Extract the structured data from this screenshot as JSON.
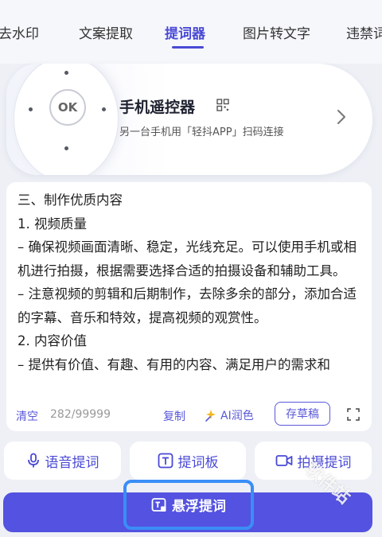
{
  "tabs": [
    {
      "label": "去水印"
    },
    {
      "label": "文案提取"
    },
    {
      "label": "提词器"
    },
    {
      "label": "图片转文字"
    },
    {
      "label": "违禁词"
    }
  ],
  "remote": {
    "ok_label": "OK",
    "title": "手机遥控器",
    "subtitle": "另一台手机用「轻抖APP」扫码连接"
  },
  "editor": {
    "lines": [
      "三、制作优质内容",
      "1. 视频质量",
      "– 确保视频画面清晰、稳定，光线充足。可以使用手机或相机进行拍摄，根据需要选择合适的拍摄设备和辅助工具。",
      "– 注意视频的剪辑和后期制作，去除多余的部分，添加合适的字幕、音乐和特效，提高视频的观赏性。",
      "2. 内容价值",
      "– 提供有价值、有趣、有用的内容、满足用户的需求和"
    ],
    "clear_label": "清空",
    "char_count": "282/99999",
    "copy_label": "复制",
    "ai_label": "AI润色",
    "draft_label": "存草稿"
  },
  "actions": {
    "voice_label": "语音提词",
    "board_label": "提词板",
    "shoot_label": "拍摄提词"
  },
  "float": {
    "label": "悬浮提词"
  },
  "watermark": "软件站",
  "colors": {
    "accent": "#4a49d6",
    "highlight": "#3a8ef6",
    "float_bg": "#5452e0"
  }
}
